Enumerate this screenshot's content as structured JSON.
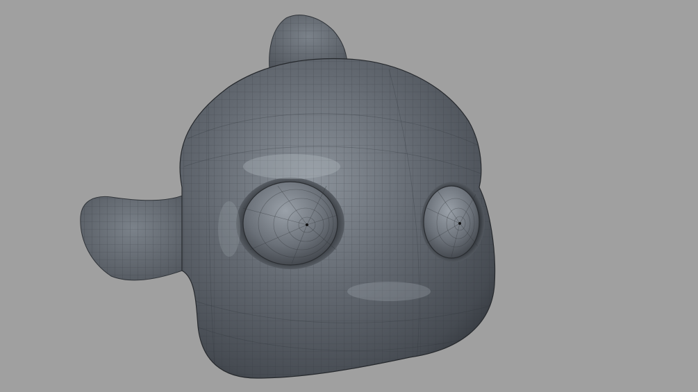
{
  "viewport": {
    "background": "#a0a0a0",
    "model": {
      "mesh_color": "#5f646b",
      "wire_color": "#2f3338",
      "highlight_color": "#8a9098",
      "shadow_color": "#3a3e44"
    }
  }
}
